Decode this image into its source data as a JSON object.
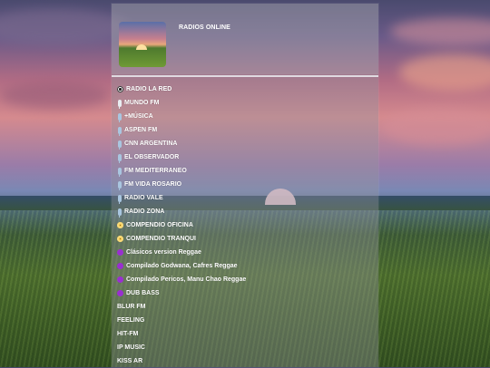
{
  "header": {
    "title": "RADIOS ONLINE"
  },
  "stations": [
    {
      "label": "RADIO LA RED",
      "icon": "soccer-ball-icon"
    },
    {
      "label": "MUNDO FM",
      "icon": "microphone-icon"
    },
    {
      "label": "+MÚSICA",
      "icon": "microphone-icon"
    },
    {
      "label": "ASPEN FM",
      "icon": "microphone-icon"
    },
    {
      "label": "CNN ARGENTINA",
      "icon": "microphone-icon"
    },
    {
      "label": "EL OBSERVADOR",
      "icon": "microphone-icon"
    },
    {
      "label": "FM MEDITERRANEO",
      "icon": "microphone-icon"
    },
    {
      "label": "FM VIDA ROSARIO",
      "icon": "microphone-icon"
    },
    {
      "label": "RADIO VALE",
      "icon": "microphone-icon"
    },
    {
      "label": "RADIO ZONA",
      "icon": "microphone-icon"
    },
    {
      "label": "COMPENDIO OFICINA",
      "icon": "disc-icon"
    },
    {
      "label": "COMPENDIO TRANQUI",
      "icon": "disc-icon"
    },
    {
      "label": "Clásicos version Reggae",
      "icon": "purple-circle-icon"
    },
    {
      "label": "Compilado Godwana, Cafres Reggae",
      "icon": "purple-circle-icon"
    },
    {
      "label": "Compilado Pericos, Manu Chao Reggae",
      "icon": "purple-circle-icon"
    },
    {
      "label": "DUB BASS",
      "icon": "purple-circle-icon"
    },
    {
      "label": "BLUR FM",
      "icon": ""
    },
    {
      "label": "FEELING",
      "icon": ""
    },
    {
      "label": "HIT-FM",
      "icon": ""
    },
    {
      "label": "IP MUSIC",
      "icon": ""
    },
    {
      "label": "KISS AR",
      "icon": ""
    }
  ],
  "colors": {
    "text": "#ffffff",
    "purple_icon": "#9a2fd1",
    "disc_icon": "#f2c34a"
  }
}
